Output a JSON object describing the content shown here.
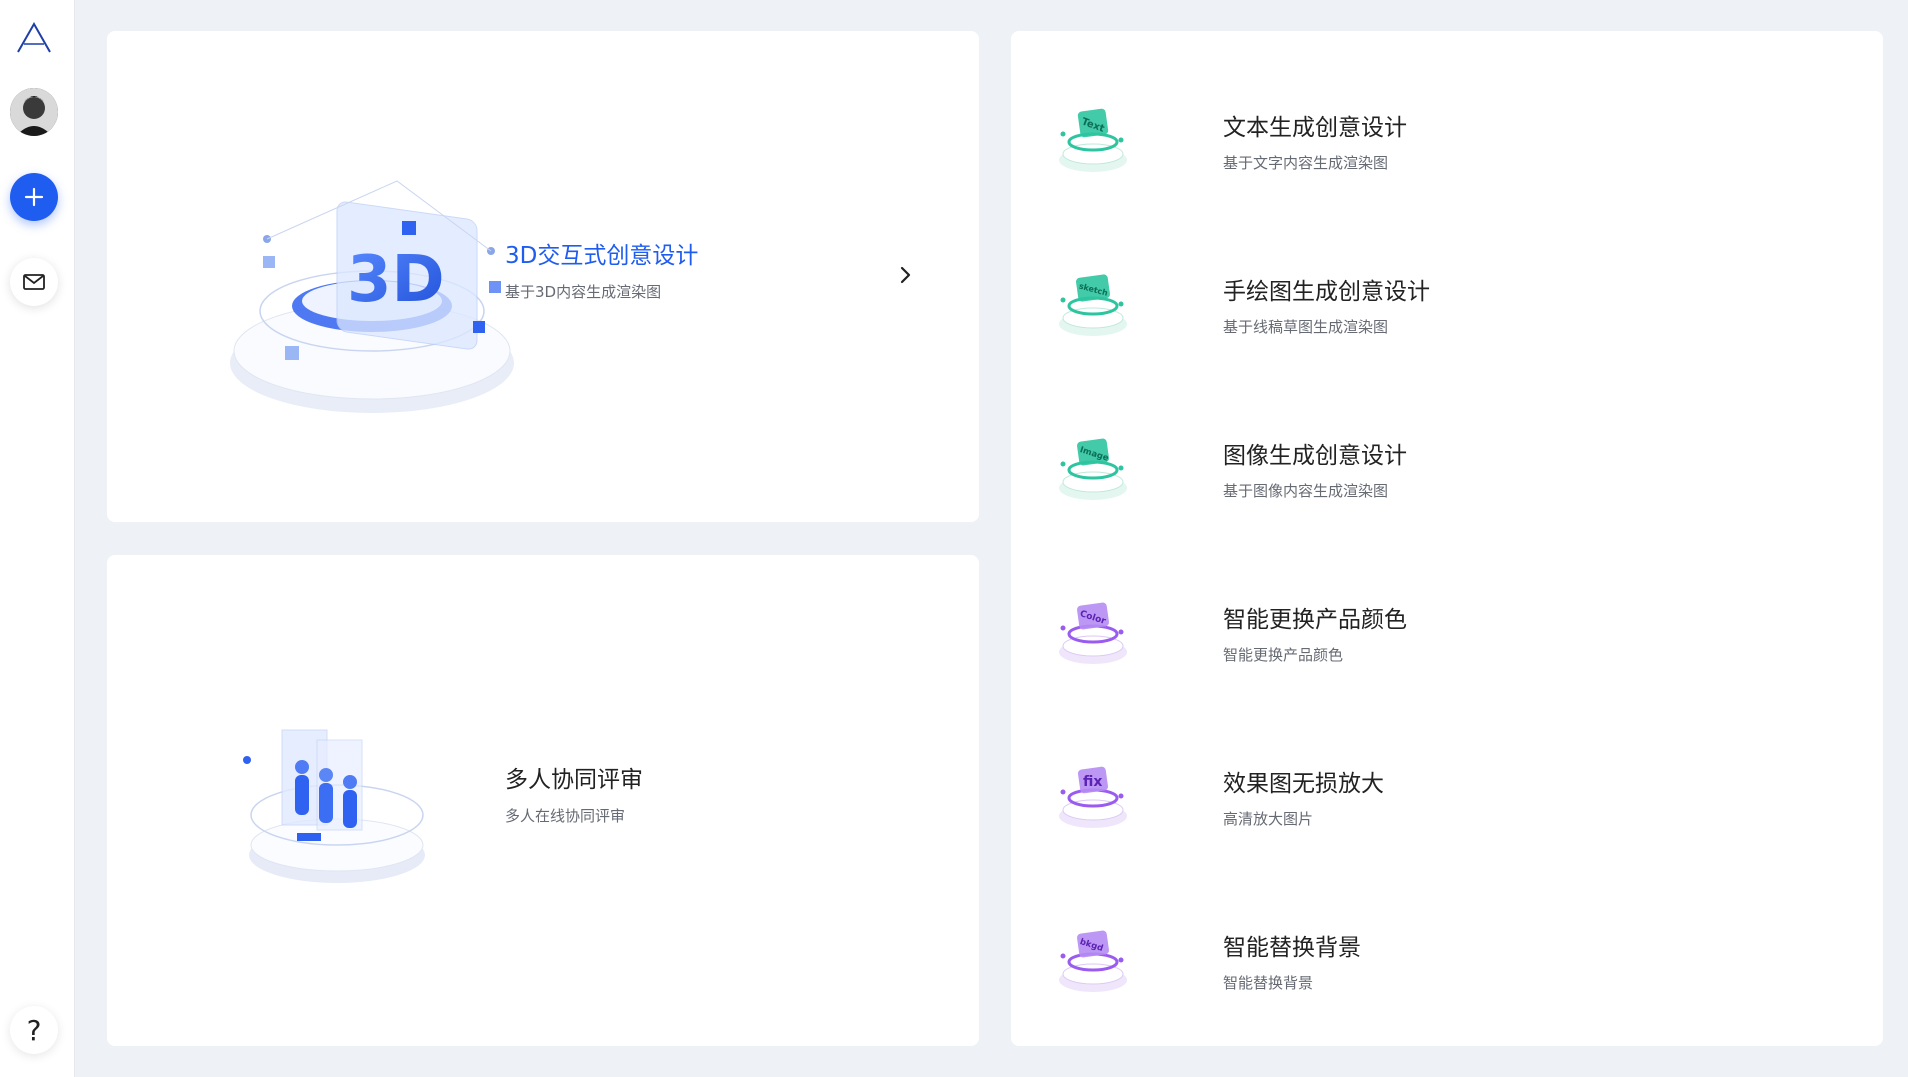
{
  "sidebar": {
    "logo_icon": "logo-a-icon",
    "add_icon": "plus-icon",
    "mail_icon": "mail-icon",
    "help_label": "?"
  },
  "featured": {
    "three_d": {
      "title": "3D交互式创意设计",
      "desc": "基于3D内容生成渲染图",
      "illus_text": "3D",
      "accent": "#1f5cf0"
    },
    "review": {
      "title": "多人协同评审",
      "desc": "多人在线协同评审"
    }
  },
  "tools": [
    {
      "title": "文本生成创意设计",
      "desc": "基于文字内容生成渲染图",
      "badge": "Text",
      "color": "#2ec4a0"
    },
    {
      "title": "手绘图生成创意设计",
      "desc": "基于线稿草图生成渲染图",
      "badge": "sketch",
      "color": "#2ec4a0"
    },
    {
      "title": "图像生成创意设计",
      "desc": "基于图像内容生成渲染图",
      "badge": "Image",
      "color": "#2ec4a0"
    },
    {
      "title": "智能更换产品颜色",
      "desc": "智能更换产品颜色",
      "badge": "Color",
      "color": "#9a5cf0"
    },
    {
      "title": "效果图无损放大",
      "desc": "高清放大图片",
      "badge": "fix",
      "color": "#9a5cf0"
    },
    {
      "title": "智能替换背景",
      "desc": "智能替换背景",
      "badge": "bkgd",
      "color": "#9a5cf0"
    }
  ]
}
